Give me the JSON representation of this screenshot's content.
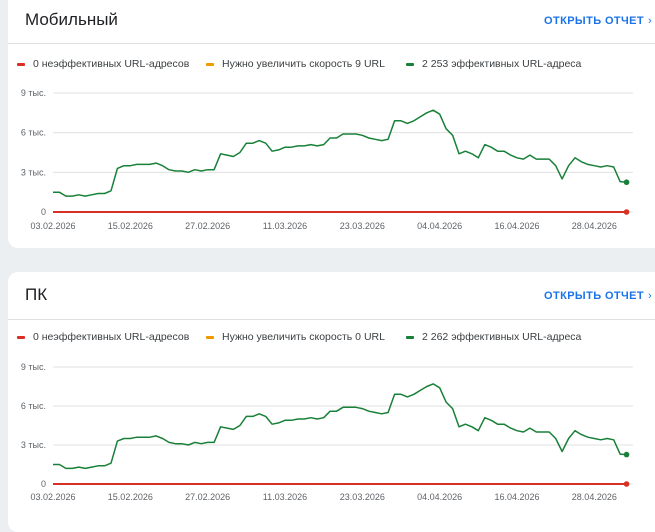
{
  "cards": [
    {
      "id": "mobile",
      "title": "Мобильный",
      "open_report_label": "ОТКРЫТЬ ОТЧЕТ",
      "legend": [
        {
          "label": "0 неэффективных URL-адресов",
          "color": "#d93025"
        },
        {
          "label": "Нужно увеличить скорость 9 URL",
          "color": "#f29900"
        },
        {
          "label": "2 253 эффективных URL-адреса",
          "color": "#188038"
        }
      ],
      "chart_data": {
        "type": "line",
        "y_ticks": [
          {
            "value": 9000,
            "label": "9 тыс."
          },
          {
            "value": 6000,
            "label": "6 тыс."
          },
          {
            "value": 3000,
            "label": "3 тыс."
          },
          {
            "value": 0,
            "label": "0"
          }
        ],
        "ylim": [
          0,
          9000
        ],
        "x_ticks": [
          "03.02.2026",
          "15.02.2026",
          "27.02.2026",
          "11.03.2026",
          "23.03.2026",
          "04.04.2026",
          "16.04.2026",
          "28.04.2026"
        ],
        "x_range": [
          "2026-02-03",
          "2026-05-04"
        ],
        "series": [
          {
            "name": "2 253 эффективных URL-адреса",
            "color": "#188038",
            "x": [
              "2026-02-03",
              "2026-02-04",
              "2026-02-05",
              "2026-02-06",
              "2026-02-07",
              "2026-02-08",
              "2026-02-09",
              "2026-02-10",
              "2026-02-11",
              "2026-02-12",
              "2026-02-13",
              "2026-02-14",
              "2026-02-15",
              "2026-02-16",
              "2026-02-17",
              "2026-02-18",
              "2026-02-19",
              "2026-02-20",
              "2026-02-21",
              "2026-02-22",
              "2026-02-23",
              "2026-02-24",
              "2026-02-25",
              "2026-02-26",
              "2026-02-27",
              "2026-02-28",
              "2026-03-01",
              "2026-03-02",
              "2026-03-03",
              "2026-03-04",
              "2026-03-05",
              "2026-03-06",
              "2026-03-07",
              "2026-03-08",
              "2026-03-09",
              "2026-03-10",
              "2026-03-11",
              "2026-03-12",
              "2026-03-13",
              "2026-03-14",
              "2026-03-15",
              "2026-03-16",
              "2026-03-17",
              "2026-03-18",
              "2026-03-19",
              "2026-03-20",
              "2026-03-21",
              "2026-03-22",
              "2026-03-23",
              "2026-03-24",
              "2026-03-25",
              "2026-03-26",
              "2026-03-27",
              "2026-03-28",
              "2026-03-29",
              "2026-03-30",
              "2026-03-31",
              "2026-04-01",
              "2026-04-02",
              "2026-04-03",
              "2026-04-04",
              "2026-04-05",
              "2026-04-06",
              "2026-04-07",
              "2026-04-08",
              "2026-04-09",
              "2026-04-10",
              "2026-04-11",
              "2026-04-12",
              "2026-04-13",
              "2026-04-14",
              "2026-04-15",
              "2026-04-16",
              "2026-04-17",
              "2026-04-18",
              "2026-04-19",
              "2026-04-20",
              "2026-04-21",
              "2026-04-22",
              "2026-04-23",
              "2026-04-24",
              "2026-04-25",
              "2026-04-26",
              "2026-04-27",
              "2026-04-28",
              "2026-04-29",
              "2026-04-30",
              "2026-05-01",
              "2026-05-02",
              "2026-05-03"
            ],
            "values": [
              1500,
              1500,
              1200,
              1200,
              1300,
              1200,
              1300,
              1400,
              1400,
              1600,
              3300,
              3500,
              3500,
              3600,
              3600,
              3600,
              3700,
              3500,
              3200,
              3100,
              3100,
              3000,
              3200,
              3100,
              3200,
              3200,
              4400,
              4300,
              4200,
              4500,
              5200,
              5200,
              5400,
              5200,
              4600,
              4700,
              4900,
              4900,
              5000,
              5000,
              5100,
              5000,
              5100,
              5600,
              5600,
              5900,
              5900,
              5900,
              5800,
              5600,
              5500,
              5400,
              5500,
              6900,
              6900,
              6700,
              6900,
              7200,
              7500,
              7700,
              7400,
              6300,
              5800,
              4400,
              4600,
              4400,
              4100,
              5100,
              4900,
              4600,
              4600,
              4300,
              4100,
              4000,
              4300,
              4000,
              4000,
              4000,
              3500,
              2500,
              3500,
              4100,
              3800,
              3600,
              3500,
              3400,
              3500,
              3400,
              2300,
              2253
            ]
          },
          {
            "name": "0 неэффективных URL-адресов",
            "color": "#d93025",
            "x": [
              "2026-02-03",
              "2026-05-03"
            ],
            "values": [
              0,
              0
            ]
          }
        ]
      }
    },
    {
      "id": "pc",
      "title": "ПК",
      "open_report_label": "ОТКРЫТЬ ОТЧЕТ",
      "legend": [
        {
          "label": "0 неэффективных URL-адресов",
          "color": "#d93025"
        },
        {
          "label": "Нужно увеличить скорость 0 URL",
          "color": "#f29900"
        },
        {
          "label": "2 262 эффективных URL-адреса",
          "color": "#188038"
        }
      ],
      "chart_data": {
        "type": "line",
        "y_ticks": [
          {
            "value": 9000,
            "label": "9 тыс."
          },
          {
            "value": 6000,
            "label": "6 тыс."
          },
          {
            "value": 3000,
            "label": "3 тыс."
          },
          {
            "value": 0,
            "label": "0"
          }
        ],
        "ylim": [
          0,
          9000
        ],
        "x_ticks": [
          "03.02.2026",
          "15.02.2026",
          "27.02.2026",
          "11.03.2026",
          "23.03.2026",
          "04.04.2026",
          "16.04.2026",
          "28.04.2026"
        ],
        "x_range": [
          "2026-02-03",
          "2026-05-04"
        ],
        "series": [
          {
            "name": "2 262 эффективных URL-адреса",
            "color": "#188038",
            "x": [
              "2026-02-03",
              "2026-02-04",
              "2026-02-05",
              "2026-02-06",
              "2026-02-07",
              "2026-02-08",
              "2026-02-09",
              "2026-02-10",
              "2026-02-11",
              "2026-02-12",
              "2026-02-13",
              "2026-02-14",
              "2026-02-15",
              "2026-02-16",
              "2026-02-17",
              "2026-02-18",
              "2026-02-19",
              "2026-02-20",
              "2026-02-21",
              "2026-02-22",
              "2026-02-23",
              "2026-02-24",
              "2026-02-25",
              "2026-02-26",
              "2026-02-27",
              "2026-02-28",
              "2026-03-01",
              "2026-03-02",
              "2026-03-03",
              "2026-03-04",
              "2026-03-05",
              "2026-03-06",
              "2026-03-07",
              "2026-03-08",
              "2026-03-09",
              "2026-03-10",
              "2026-03-11",
              "2026-03-12",
              "2026-03-13",
              "2026-03-14",
              "2026-03-15",
              "2026-03-16",
              "2026-03-17",
              "2026-03-18",
              "2026-03-19",
              "2026-03-20",
              "2026-03-21",
              "2026-03-22",
              "2026-03-23",
              "2026-03-24",
              "2026-03-25",
              "2026-03-26",
              "2026-03-27",
              "2026-03-28",
              "2026-03-29",
              "2026-03-30",
              "2026-03-31",
              "2026-04-01",
              "2026-04-02",
              "2026-04-03",
              "2026-04-04",
              "2026-04-05",
              "2026-04-06",
              "2026-04-07",
              "2026-04-08",
              "2026-04-09",
              "2026-04-10",
              "2026-04-11",
              "2026-04-12",
              "2026-04-13",
              "2026-04-14",
              "2026-04-15",
              "2026-04-16",
              "2026-04-17",
              "2026-04-18",
              "2026-04-19",
              "2026-04-20",
              "2026-04-21",
              "2026-04-22",
              "2026-04-23",
              "2026-04-24",
              "2026-04-25",
              "2026-04-26",
              "2026-04-27",
              "2026-04-28",
              "2026-04-29",
              "2026-04-30",
              "2026-05-01",
              "2026-05-02",
              "2026-05-03"
            ],
            "values": [
              1500,
              1500,
              1200,
              1200,
              1300,
              1200,
              1300,
              1400,
              1400,
              1600,
              3300,
              3500,
              3500,
              3600,
              3600,
              3600,
              3700,
              3500,
              3200,
              3100,
              3100,
              3000,
              3200,
              3100,
              3200,
              3200,
              4400,
              4300,
              4200,
              4500,
              5200,
              5200,
              5400,
              5200,
              4600,
              4700,
              4900,
              4900,
              5000,
              5000,
              5100,
              5000,
              5100,
              5600,
              5600,
              5900,
              5900,
              5900,
              5800,
              5600,
              5500,
              5400,
              5500,
              6900,
              6900,
              6700,
              6900,
              7200,
              7500,
              7700,
              7400,
              6300,
              5800,
              4400,
              4600,
              4400,
              4100,
              5100,
              4900,
              4600,
              4600,
              4300,
              4100,
              4000,
              4300,
              4000,
              4000,
              4000,
              3500,
              2500,
              3500,
              4100,
              3800,
              3600,
              3500,
              3400,
              3500,
              3400,
              2300,
              2262
            ]
          },
          {
            "name": "0 неэффективных URL-адресов",
            "color": "#d93025",
            "x": [
              "2026-02-03",
              "2026-05-03"
            ],
            "values": [
              0,
              0
            ]
          }
        ]
      }
    }
  ]
}
